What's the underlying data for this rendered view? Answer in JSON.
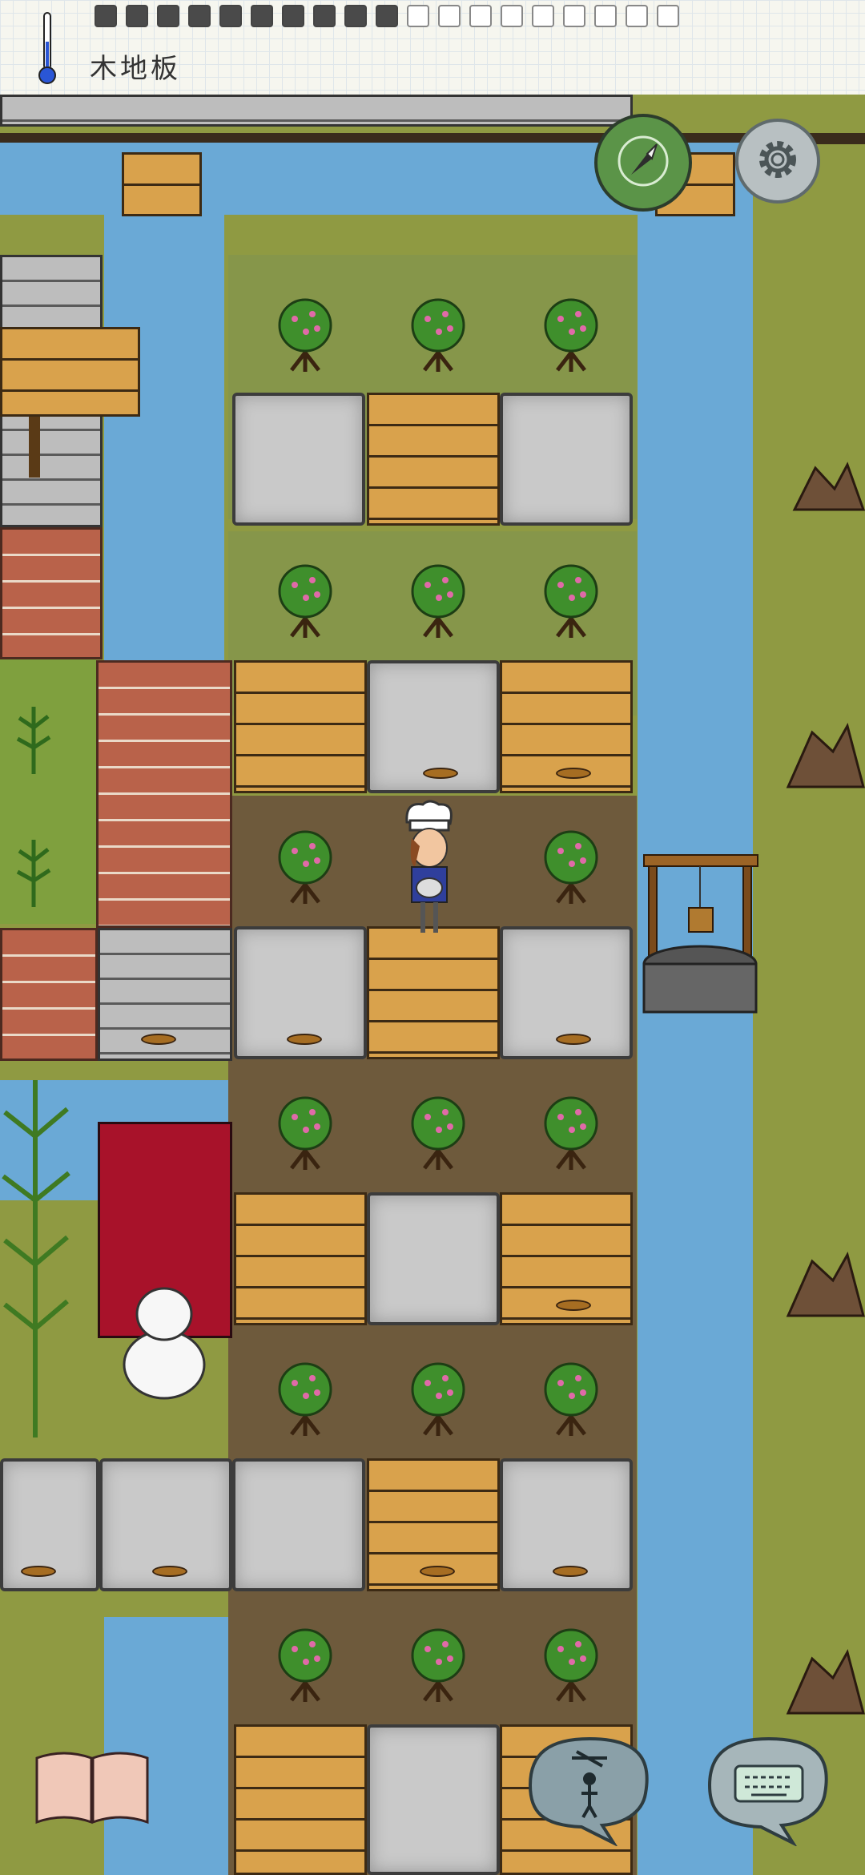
{
  "hud": {
    "tile_label": "木地板",
    "food_pips": {
      "filled": 10,
      "total": 19
    },
    "temperature_icon": "thermometer-icon"
  },
  "controls": {
    "compass_icon": "compass-icon",
    "settings_icon": "gear-icon",
    "book_icon": "recipe-book-icon",
    "puppet_icon": "puppet-emote-icon",
    "keyboard_icon": "keyboard-chat-icon"
  },
  "colors": {
    "water": "#6aa9d6",
    "grass": "#8f9a42",
    "plank": "#d9a24c",
    "stone": "#c9c9c9",
    "brick": "#b9624a",
    "red_block": "#a8122a"
  }
}
